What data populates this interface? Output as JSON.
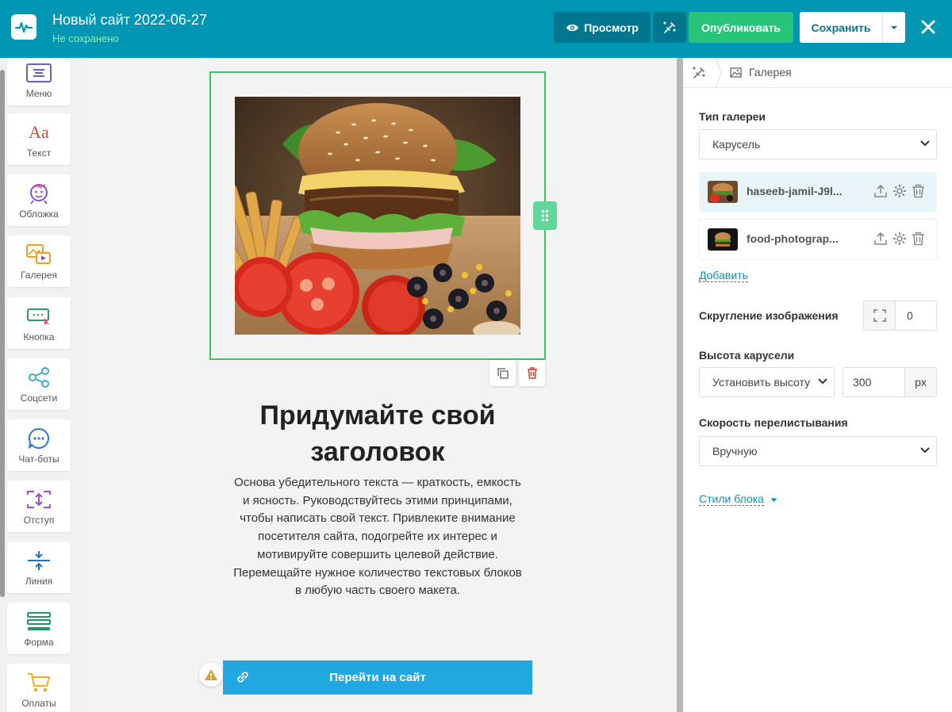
{
  "header": {
    "site_title": "Новый сайт 2022-06-27",
    "status": "Не сохранено",
    "preview_label": "Просмотр",
    "publish_label": "Опубликовать",
    "save_label": "Сохранить"
  },
  "sidebar": {
    "items": [
      {
        "label": "Меню",
        "icon": "menu-icon"
      },
      {
        "label": "Текст",
        "icon": "text-aa-icon"
      },
      {
        "label": "Обложка",
        "icon": "cover-icon"
      },
      {
        "label": "Галерея",
        "icon": "gallery-icon"
      },
      {
        "label": "Кнопка",
        "icon": "button-icon"
      },
      {
        "label": "Соцсети",
        "icon": "share-icon"
      },
      {
        "label": "Чат-боты",
        "icon": "chat-icon"
      },
      {
        "label": "Отступ",
        "icon": "spacing-icon"
      },
      {
        "label": "Линия",
        "icon": "line-icon"
      },
      {
        "label": "Форма",
        "icon": "form-icon"
      },
      {
        "label": "Оплаты",
        "icon": "cart-icon"
      }
    ]
  },
  "canvas": {
    "headline": "Придумайте свой заголовок",
    "body": "Основа убедительного текста — краткость, емкость и ясность. Руководствуйтесь этими принципами, чтобы написать свой текст. Привлеките внимание посетителя сайта, подогрейте их интерес и мотивируйте совершить целевой действие. Перемещайте нужное количество текстовых блоков в любую часть своего макета.",
    "cta_label": "Перейти на сайт"
  },
  "panel": {
    "breadcrumb": "Галерея",
    "gallery_type_label": "Тип галереи",
    "gallery_type_value": "Карусель",
    "images": [
      {
        "name": "haseeb-jamil-J9l..."
      },
      {
        "name": "food-photograp..."
      }
    ],
    "add_label": "Добавить",
    "radius_label": "Скругление изображения",
    "radius_value": "0",
    "height_label": "Высота карусели",
    "height_mode": "Установить высоту",
    "height_value": "300",
    "height_unit": "px",
    "speed_label": "Скорость перелистывания",
    "speed_value": "Вручную",
    "styles_label": "Стили блока"
  },
  "colors": {
    "topbar": "#0097b4",
    "publish": "#27c578",
    "selection": "#3ac466",
    "cta": "#22a8e0"
  }
}
